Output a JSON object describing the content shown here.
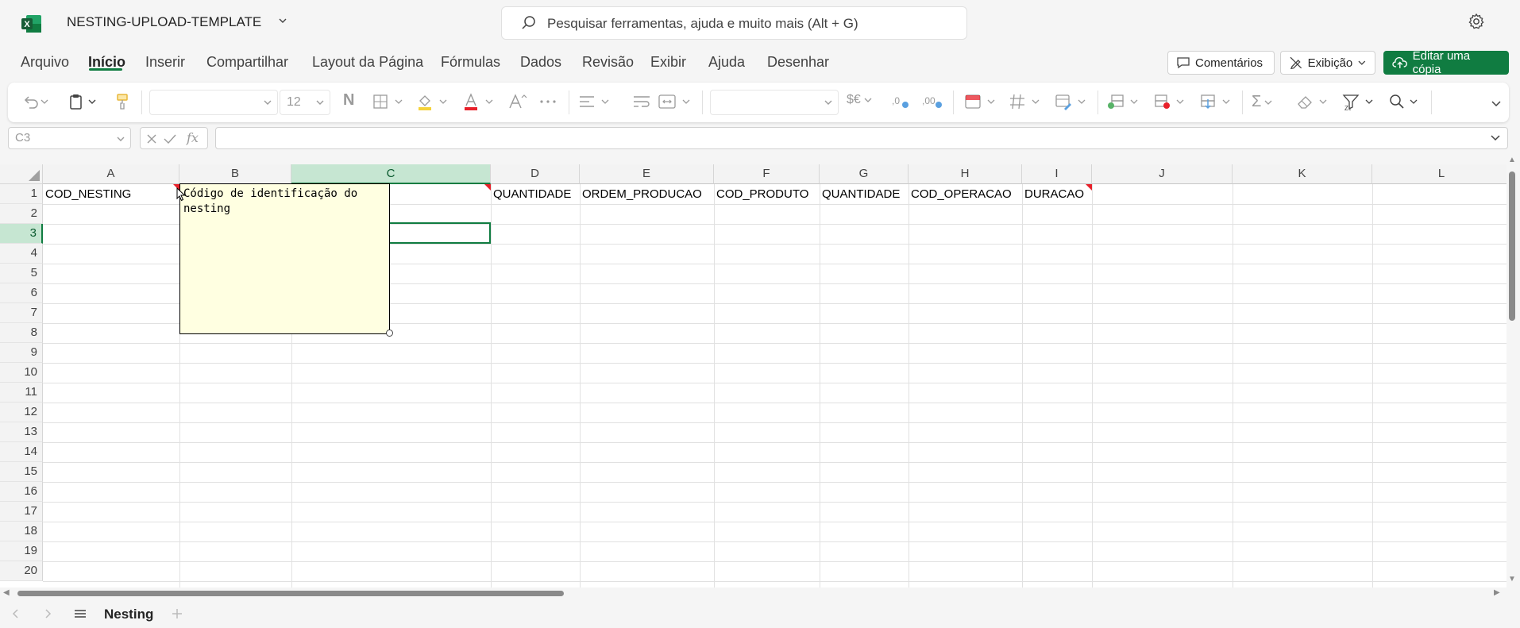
{
  "app": {
    "title": "NESTING-UPLOAD-TEMPLATE",
    "search_placeholder": "Pesquisar ferramentas, ajuda e muito mais (Alt + G)",
    "brand_color": "#107c41"
  },
  "ribbon": {
    "tabs": [
      "Arquivo",
      "Início",
      "Inserir",
      "Compartilhar",
      "Layout da Página",
      "Fórmulas",
      "Dados",
      "Revisão",
      "Exibir",
      "Ajuda",
      "Desenhar"
    ],
    "active_tab": "Início",
    "comments_label": "Comentários",
    "view_label": "Exibição",
    "edit_copy_label": "Editar uma cópia"
  },
  "toolbar": {
    "font_size": "12",
    "bold_glyph": "N",
    "currency_glyph": "$€",
    "sum_glyph": "Σ"
  },
  "formula_bar": {
    "name_box": "C3",
    "fx_label": "fx",
    "value": ""
  },
  "grid": {
    "columns": [
      "A",
      "B",
      "C",
      "D",
      "E",
      "F",
      "G",
      "H",
      "I",
      "J",
      "K",
      "L"
    ],
    "selected_column": "C",
    "rows": [
      "1",
      "2",
      "3",
      "4",
      "5",
      "6",
      "7",
      "8",
      "9",
      "10",
      "11",
      "12",
      "13",
      "14",
      "15",
      "16",
      "17",
      "18",
      "19",
      "20"
    ],
    "selected_row": "3",
    "row1": {
      "A": "COD_NESTING",
      "D": "QUANTIDADE",
      "E": "ORDEM_PRODUCAO",
      "F": "COD_PRODUTO",
      "G": "QUANTIDADE",
      "H": "COD_OPERACAO",
      "I": "DURACAO"
    }
  },
  "comment": {
    "text": "Código de identificação do\nnesting"
  },
  "sheets": {
    "active": "Nesting"
  }
}
